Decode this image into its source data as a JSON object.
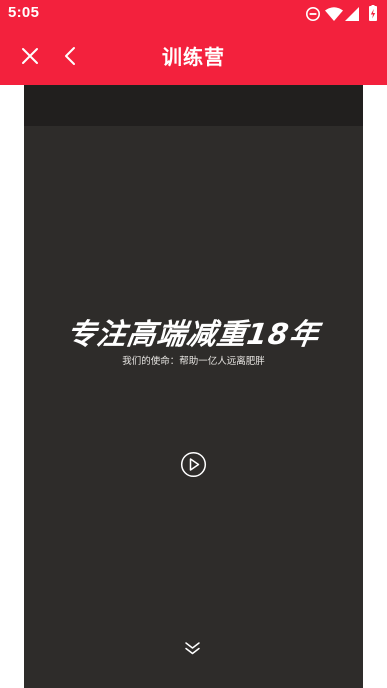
{
  "status_bar": {
    "time": "5:05",
    "icons": [
      "do-not-disturb-icon",
      "wifi-icon",
      "cell-signal-icon",
      "battery-charging-icon"
    ]
  },
  "app_bar": {
    "title": "训练营",
    "close_icon": "close-icon",
    "back_icon": "chevron-left-icon"
  },
  "content": {
    "headline": "专注高端减重18年",
    "subheadline": "我们的使命：帮助一亿人远离肥胖",
    "play_icon": "play-circle-icon",
    "scroll_icon": "double-chevron-down-icon"
  },
  "colors": {
    "brand_red": "#f3213d",
    "panel_dark": "#2e2c2a",
    "panel_top": "#211f1e"
  }
}
